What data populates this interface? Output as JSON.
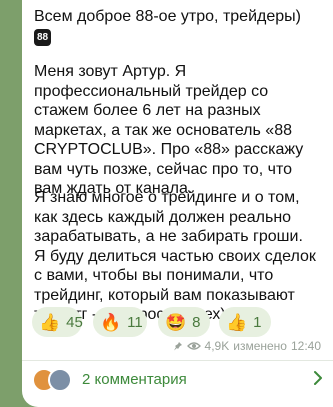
{
  "message": {
    "greeting": "Всем доброе 88-ое утро, трейдеры)",
    "emoji_label": "88",
    "paragraph1": [
      "Меня зовут Артур. Я",
      "профессиональный трейдер со",
      "стажем более 6 лет на разных",
      "маркетах, а так же основатель «88",
      "CRYPTOCLUB». Про «88» расскажу",
      "вам чуть позже, сейчас про то, что",
      "вам ждать от канала."
    ],
    "paragraph2": [
      "Я знаю многое о трейдинге и о том,",
      "как здесь каждый должен реально",
      "зарабатывать, а не забирать гроши.",
      "Я буду делиться частью своих сделок",
      "с вами, чтобы вы понимали, что",
      "трейдинг, который вам показывают",
      "тут в тг - это просто смех)"
    ]
  },
  "reactions": [
    {
      "emoji": "👍",
      "count": "45"
    },
    {
      "emoji": "🔥",
      "count": "11"
    },
    {
      "emoji": "🤩",
      "count": "8"
    },
    {
      "emoji": "👍",
      "count": "1"
    }
  ],
  "meta": {
    "pin_icon": "pin-icon",
    "views_icon": "eye-icon",
    "views": "4,9K",
    "edited": "изменено",
    "time": "12:40"
  },
  "comments": {
    "label": "2 комментария",
    "avatar_colors": [
      "#e0923e",
      "#7c8fa6"
    ]
  },
  "colors": {
    "background": "#7d9f6b",
    "bubble": "#ffffff",
    "accent": "#3d8a3b"
  }
}
